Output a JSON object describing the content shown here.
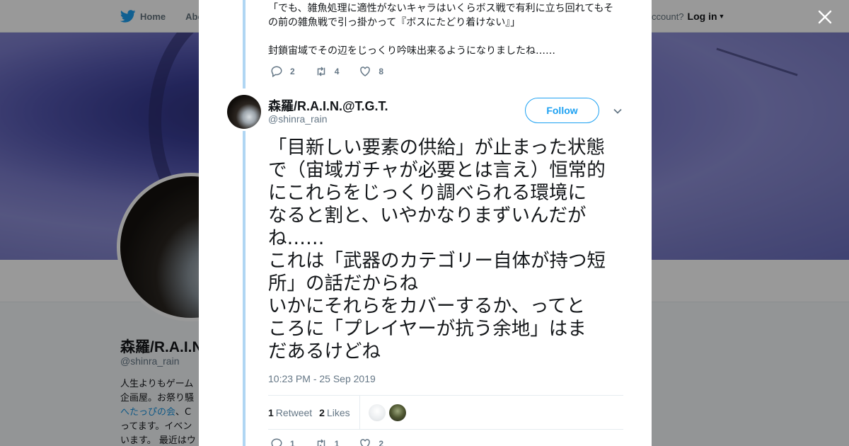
{
  "background": {
    "nav": {
      "home_label": "Home",
      "about_label": "Abo"
    },
    "account": {
      "prompt": "ccount?",
      "login_label": "Log in"
    },
    "profile": {
      "name": "森羅/R.A.I.N",
      "handle": "@shinra_rain",
      "bio_line1": "人生よりもゲーム",
      "bio_line2": "企画屋。お祭り騒",
      "bio_link": "へたっぴの会",
      "bio_line3_rest": "、C",
      "bio_line4": "ってます。イベン",
      "bio_line5": "います。 最近はウ"
    }
  },
  "modal": {
    "previous_tweet": {
      "text_line1": "「でも、雑魚処理に適性がないキャラはいくらボス戦で有利に立ち回れてもそ",
      "text_line2": "の前の雑魚戦で引っ掛かって『ボスにたどり着けない』」",
      "text_line3": "封鎖宙域でその辺をじっくり吟味出来るようになりましたね……",
      "reply_count": "2",
      "retweet_count": "4",
      "like_count": "8"
    },
    "tweet": {
      "author_name": "森羅/R.A.I.N.@T.G.T.",
      "author_handle": "@shinra_rain",
      "follow_label": "Follow",
      "text_lines": [
        "「目新しい要素の供給」が止まった状態",
        "で（宙域ガチャが必要とは言え）恒常的",
        "にこれらをじっくり調べられる環境に",
        "なると割と、いやかなりまずいんだが",
        "ね……",
        "これは「武器のカテゴリー自体が持つ短",
        "所」の話だからね",
        "いかにそれらをカバーするか、ってと",
        "ころに「プレイヤーが抗う余地」はま",
        "だあるけどね"
      ],
      "timestamp": "10:23 PM - 25 Sep 2019",
      "retweets": {
        "count": "1",
        "label": "Retweet"
      },
      "likes": {
        "count": "2",
        "label": "Likes"
      },
      "reply_count": "1",
      "retweet_count": "1",
      "like_count": "2"
    }
  },
  "colors": {
    "accent": "#1da1f2",
    "thread_line": "#b0d6f3",
    "muted_text": "#657786",
    "banner": "#6b6fbe"
  },
  "icons": [
    "twitter-bird-icon",
    "close-icon",
    "reply-icon",
    "retweet-icon",
    "like-icon",
    "chevron-down-icon"
  ]
}
